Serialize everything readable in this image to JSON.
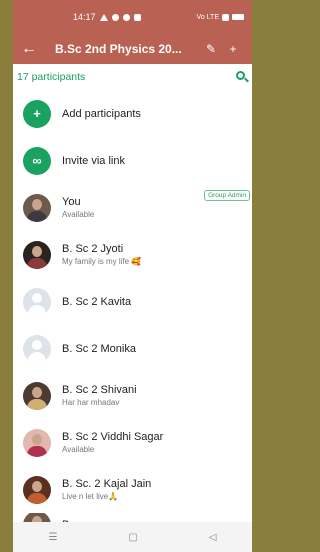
{
  "statusbar": {
    "time": "14:17",
    "network": "Vo LTE"
  },
  "appbar": {
    "title": "B.Sc 2nd Physics 20..."
  },
  "participants_count": "17 participants",
  "actions": [
    {
      "label": "Add participants",
      "icon": "add-person-icon"
    },
    {
      "label": "Invite via link",
      "icon": "link-icon"
    }
  ],
  "members": [
    {
      "name": "You",
      "status": "Available",
      "badge": "Group Admin",
      "avatar": "photo"
    },
    {
      "name": "B. Sc 2 Jyoti",
      "status": "My family is my life 🥰",
      "avatar": "photo"
    },
    {
      "name": "B. Sc 2 Kavita",
      "status": "",
      "avatar": "default"
    },
    {
      "name": "B. Sc 2 Monika",
      "status": "",
      "avatar": "default"
    },
    {
      "name": "B. Sc 2 Shivani",
      "status": "Har har mhadav",
      "avatar": "photo"
    },
    {
      "name": "B. Sc 2 Viddhi Sagar",
      "status": "Available",
      "avatar": "photo"
    },
    {
      "name": "B. Sc. 2 Kajal Jain",
      "status": "Live n let live🙏",
      "avatar": "photo"
    },
    {
      "name": "B. ...",
      "status": "",
      "avatar": "photo"
    }
  ],
  "colors": {
    "header": "#b96152",
    "accent": "#1aa260"
  }
}
